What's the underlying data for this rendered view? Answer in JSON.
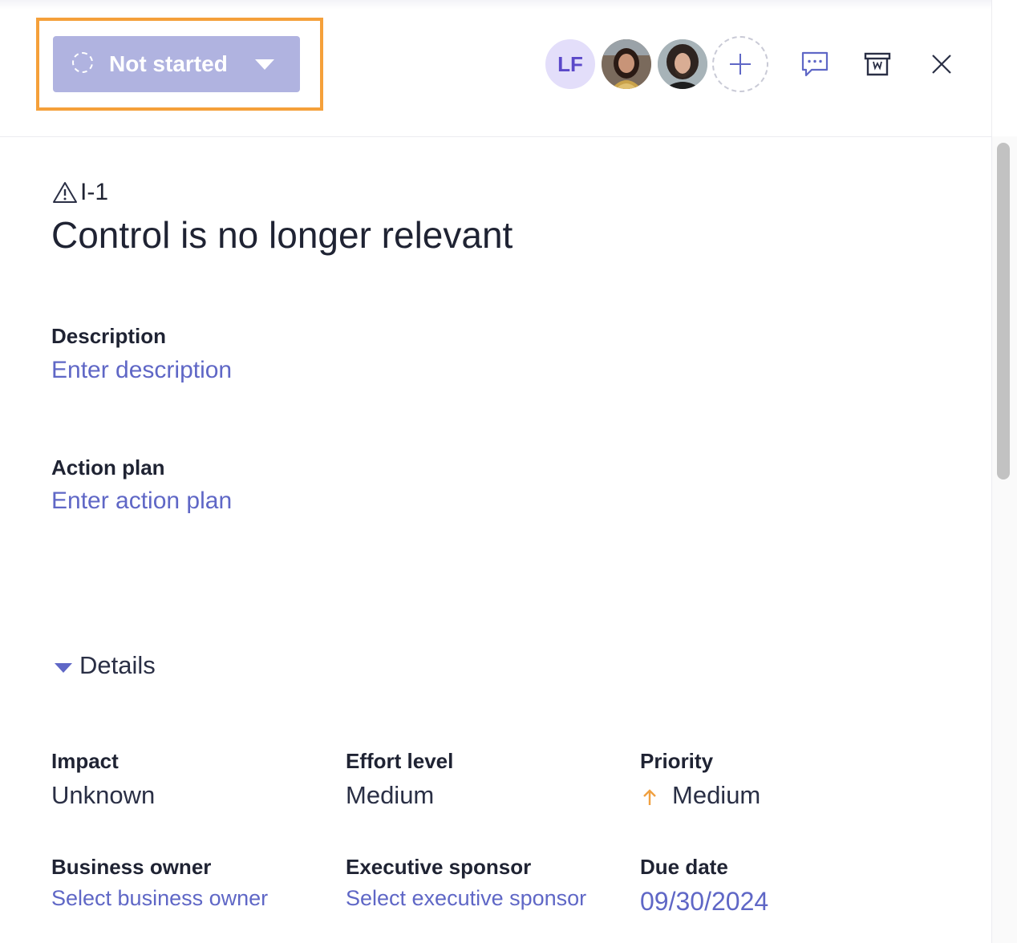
{
  "header": {
    "status": {
      "label": "Not started",
      "icon": "spinner-dashed-icon",
      "color": "#b0b3e0"
    },
    "assignees": [
      {
        "initials": "LF",
        "type": "initials"
      },
      {
        "type": "photo"
      },
      {
        "type": "photo"
      }
    ],
    "actions": [
      "comment-icon",
      "archive-icon",
      "close-icon"
    ]
  },
  "issue": {
    "id": "I-1",
    "title": "Control is no longer relevant"
  },
  "description": {
    "label": "Description",
    "placeholder": "Enter description"
  },
  "action_plan": {
    "label": "Action plan",
    "placeholder": "Enter action plan"
  },
  "details": {
    "toggle_label": "Details",
    "impact": {
      "label": "Impact",
      "value": "Unknown"
    },
    "effort": {
      "label": "Effort level",
      "value": "Medium"
    },
    "priority": {
      "label": "Priority",
      "value": "Medium",
      "icon": "arrow-up-icon",
      "icon_color": "#f0a040"
    },
    "business_owner": {
      "label": "Business owner",
      "value": "Select business owner"
    },
    "executive_sponsor": {
      "label": "Executive sponsor",
      "value": "Select executive sponsor"
    },
    "due_date": {
      "label": "Due date",
      "value": "09/30/2024"
    }
  },
  "colors": {
    "highlight": "#f5a03a",
    "link": "#5f67c6",
    "accent": "#5b48c9"
  }
}
